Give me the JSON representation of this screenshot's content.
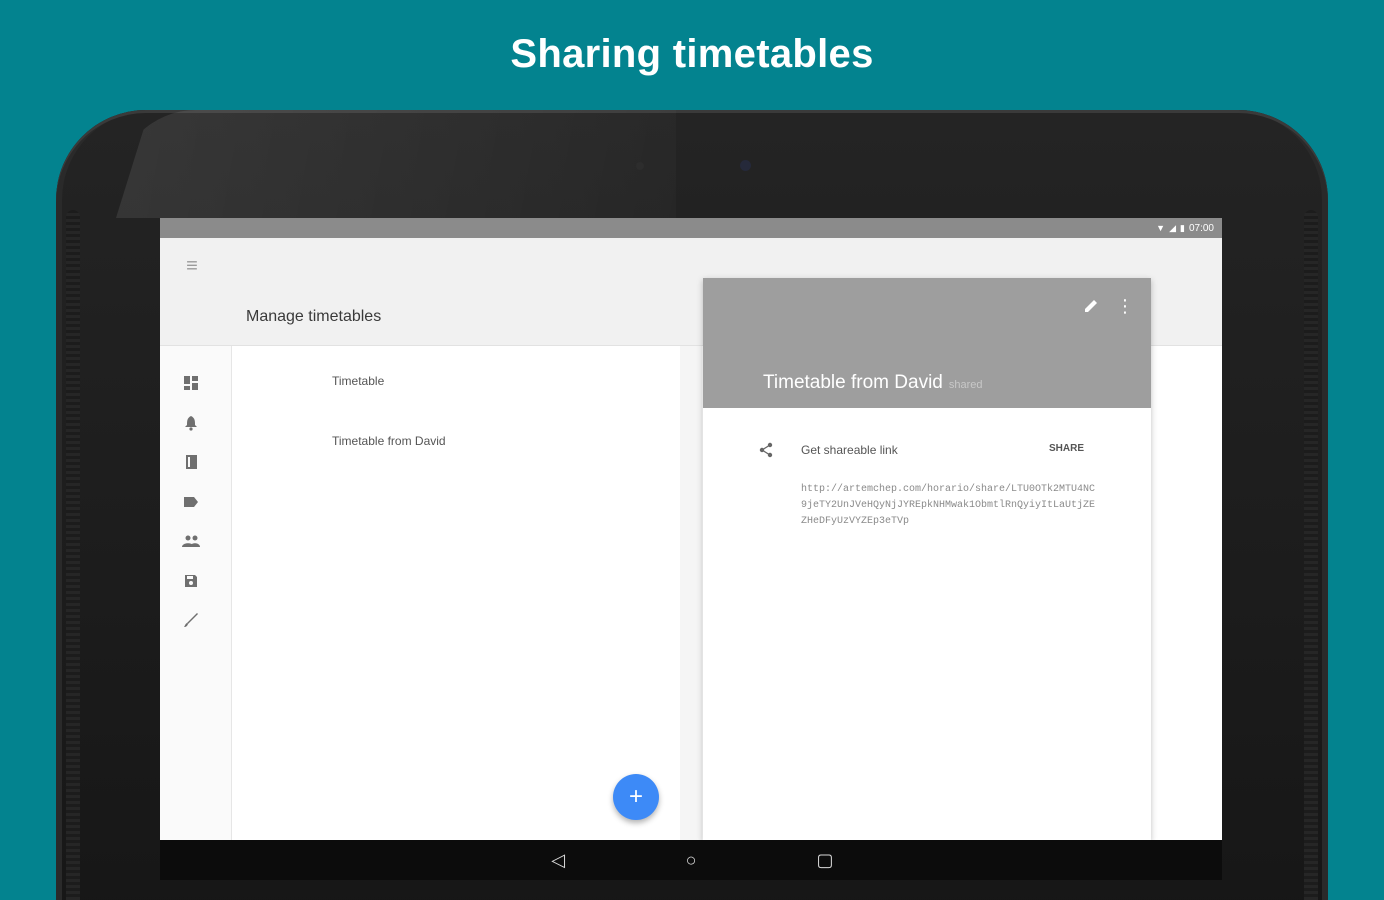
{
  "headline": "Sharing timetables",
  "status_bar": {
    "time": "07:00",
    "icons": [
      "wifi-icon",
      "signal-icon",
      "battery-icon"
    ]
  },
  "app_bar": {
    "title": "Manage timetables",
    "menu_icon": "menu-icon"
  },
  "rail": {
    "icons": [
      "dashboard-icon",
      "bell-icon",
      "book-icon",
      "label-icon",
      "people-icon",
      "save-icon",
      "brush-icon"
    ]
  },
  "timetables": {
    "items": [
      {
        "label": "Timetable"
      },
      {
        "label": "Timetable from David"
      }
    ],
    "fab_label": "+"
  },
  "detail": {
    "title": "Timetable from David",
    "badge": "shared",
    "get_link_label": "Get shareable link",
    "share_button_label": "SHARE",
    "link": "http://artemchep.com/horario/share/LTU0OTk2MTU4NC9jeTY2UnJVeHQyNjJYREpkNHMwak1ObmtlRnQyiyItLaUtjZEZHeDFyUzVYZEp3eTVp"
  },
  "colors": {
    "background": "#03838f",
    "fab": "#3d8af7",
    "detail_header": "#9e9e9e"
  }
}
